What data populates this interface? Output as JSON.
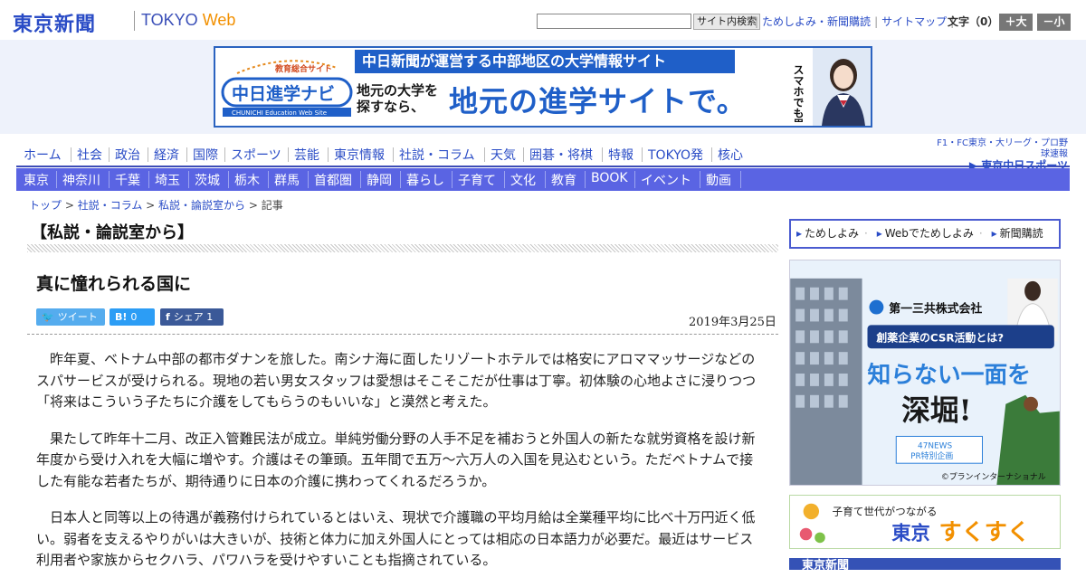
{
  "header": {
    "logo_jp": "東京新聞",
    "logo_en_main": "TOKYO",
    "logo_en_web": "Web",
    "search_placeholder": "",
    "search_button": "サイト内検索",
    "links": [
      "ためしよみ・新聞購読",
      "サイトマップ"
    ],
    "font_size_label": "文字（0）",
    "font_plus": "＋大",
    "font_minus": "－小"
  },
  "banner": {
    "logo_tag": "教育総合サイト",
    "logo_main": "中日進学ナビ",
    "logo_en": "CHUNICHI Education Web Site",
    "headline": "中日新聞が運営する中部地区の大学情報サイト",
    "sub_line1": "地元の大学を",
    "sub_line2": "探すなら、",
    "main_copy": "地元の進学サイトで。",
    "vertical_copy": "スマホでも思い立ったらすぐ検索!"
  },
  "nav_primary": [
    "ホーム",
    "社会",
    "政治",
    "経済",
    "国際",
    "スポーツ",
    "芸能",
    "東京情報",
    "社説・コラム",
    "天気",
    "囲碁・将棋",
    "特報",
    "TOKYO発",
    "核心"
  ],
  "sports_link": {
    "top": "F1・FC東京・大リーグ・プロ野球速報",
    "bottom_prefix": "東京",
    "bottom_main": "中日スポーツ"
  },
  "nav_secondary": [
    "東京",
    "神奈川",
    "千葉",
    "埼玉",
    "茨城",
    "栃木",
    "群馬",
    "首都圏",
    "静岡",
    "暮らし",
    "子育て",
    "文化",
    "教育",
    "BOOK",
    "イベント",
    "動画"
  ],
  "breadcrumb": {
    "items": [
      "トップ",
      "社説・コラム",
      "私説・論説室から"
    ],
    "sep": " > ",
    "current": "記事"
  },
  "section_title": "【私説・論説室から】",
  "article": {
    "title": "真に憧れられる国に",
    "date": "2019年3月25日",
    "share": {
      "tweet": "ツイート",
      "hatena_icon": "B!",
      "hatena_count": "0",
      "fb_icon": "f",
      "fb_label": "シェア",
      "fb_count": "1"
    },
    "paragraphs": [
      "昨年夏、ベトナム中部の都市ダナンを旅した。南シナ海に面したリゾートホテルでは格安にアロママッサージなどのスパサービスが受けられる。現地の若い男女スタッフは愛想はそこそこだが仕事は丁寧。初体験の心地よさに浸りつつ「将来はこういう子たちに介護をしてもらうのもいいな」と漠然と考えた。",
      "果たして昨年十二月、改正入管難民法が成立。単純労働分野の人手不足を補おうと外国人の新たな就労資格を設け新年度から受け入れを大幅に増やす。介護はその筆頭。五年間で五万～六万人の入国を見込むという。ただベトナムで接した有能な若者たちが、期待通りに日本の介護に携わってくれるだろうか。",
      "日本人と同等以上の待遇が義務付けられているとはいえ、現状で介護職の平均月給は全業種平均に比べ十万円近く低い。弱者を支えるやりがいは大きいが、技術と体力に加え外国人にとっては相応の日本語力が必要だ。最近はサービス利用者や家族からセクハラ、パワハラを受けやすいことも指摘されている。"
    ]
  },
  "sidebar": {
    "links": [
      "ためしよみ",
      "Webでためしよみ",
      "新聞購読"
    ],
    "ad1": {
      "company": "第一三共株式会社",
      "tagline": "創薬企業のCSR活動とは?",
      "copy1": "知らない一面を",
      "copy2": "深堀!",
      "badge_top": "47NEWS",
      "badge_bottom": "PR特別企画",
      "credit": "©プランインターナショナル"
    },
    "ad2": {
      "small": "子育て世代がつながる",
      "main_a": "東京",
      "main_b": "すくすく"
    },
    "ad3": {
      "text": "東京新聞"
    }
  },
  "colors": {
    "brand_blue": "#2a4cc6",
    "nav_purple": "#5a64e3",
    "twitter": "#55acee",
    "hatena": "#2c9df5",
    "facebook": "#3b5998"
  }
}
